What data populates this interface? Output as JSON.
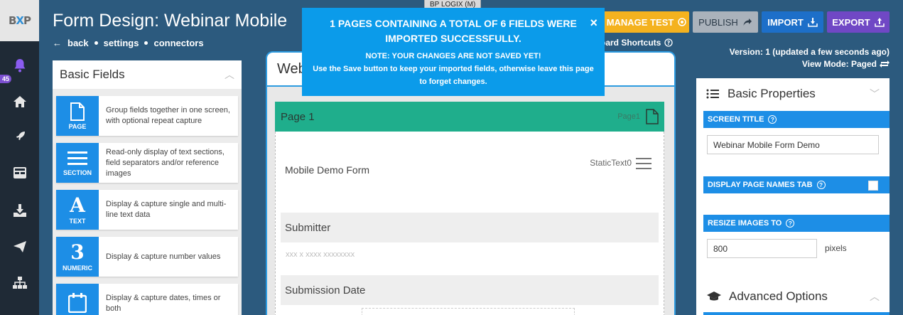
{
  "brand": {
    "logo_text_a": "B",
    "logo_text_x": "X",
    "logo_text_b": "P",
    "accent": "#1d8ee6"
  },
  "nav": {
    "notification_count": "45"
  },
  "env_tag": "BP LOGIX (M)",
  "header": {
    "title": "Form Design: Webinar Mobile",
    "links": [
      "back",
      "settings",
      "connectors"
    ],
    "shortcuts": "oard Shortcuts",
    "buttons": {
      "manage_test": "MANAGE TEST",
      "publish": "PUBLISH",
      "import": "IMPORT",
      "export": "EXPORT"
    },
    "version": "Version: 1 (updated a few seconds ago)",
    "view_mode": "View Mode: Paged"
  },
  "notification": {
    "title": "1 PAGES CONTAINING A TOTAL OF 6 FIELDS WERE IMPORTED SUCCESSFULLY.",
    "body_line1": "NOTE: YOUR CHANGES ARE NOT SAVED YET!",
    "body_line2": "Use the Save button to keep your imported fields, otherwise leave this page to forget changes.",
    "close": "×"
  },
  "left_panel": {
    "title": "Basic Fields",
    "items": [
      {
        "caption": "PAGE",
        "desc": "Group fields together in one screen, with optional repeat capture"
      },
      {
        "caption": "SECTION",
        "desc": "Read-only display of text sections, field separators and/or reference images"
      },
      {
        "caption": "TEXT",
        "desc": "Display & capture single and multi-line text data"
      },
      {
        "caption": "NUMERIC",
        "desc": "Display & capture number values"
      },
      {
        "caption": "",
        "desc": "Display & capture dates, times or both"
      }
    ]
  },
  "canvas": {
    "tab_title": "Web",
    "page_name": "Page 1",
    "page_tag": "Page1",
    "static_text": "Mobile Demo Form",
    "static_tag": "StaticText0",
    "fields": [
      {
        "label": "Submitter",
        "placeholder": "xxx x xxxx xxxxxxxx"
      },
      {
        "label": "Submission Date"
      }
    ]
  },
  "right_panel": {
    "title": "Basic Properties",
    "screen_title_label": "SCREEN TITLE",
    "screen_title_value": "Webinar Mobile Form Demo",
    "display_page_names_label": "DISPLAY PAGE NAMES TAB",
    "resize_images_label": "RESIZE IMAGES TO",
    "resize_images_value": "800",
    "pixels_label": "pixels",
    "advanced_title": "Advanced Options"
  }
}
